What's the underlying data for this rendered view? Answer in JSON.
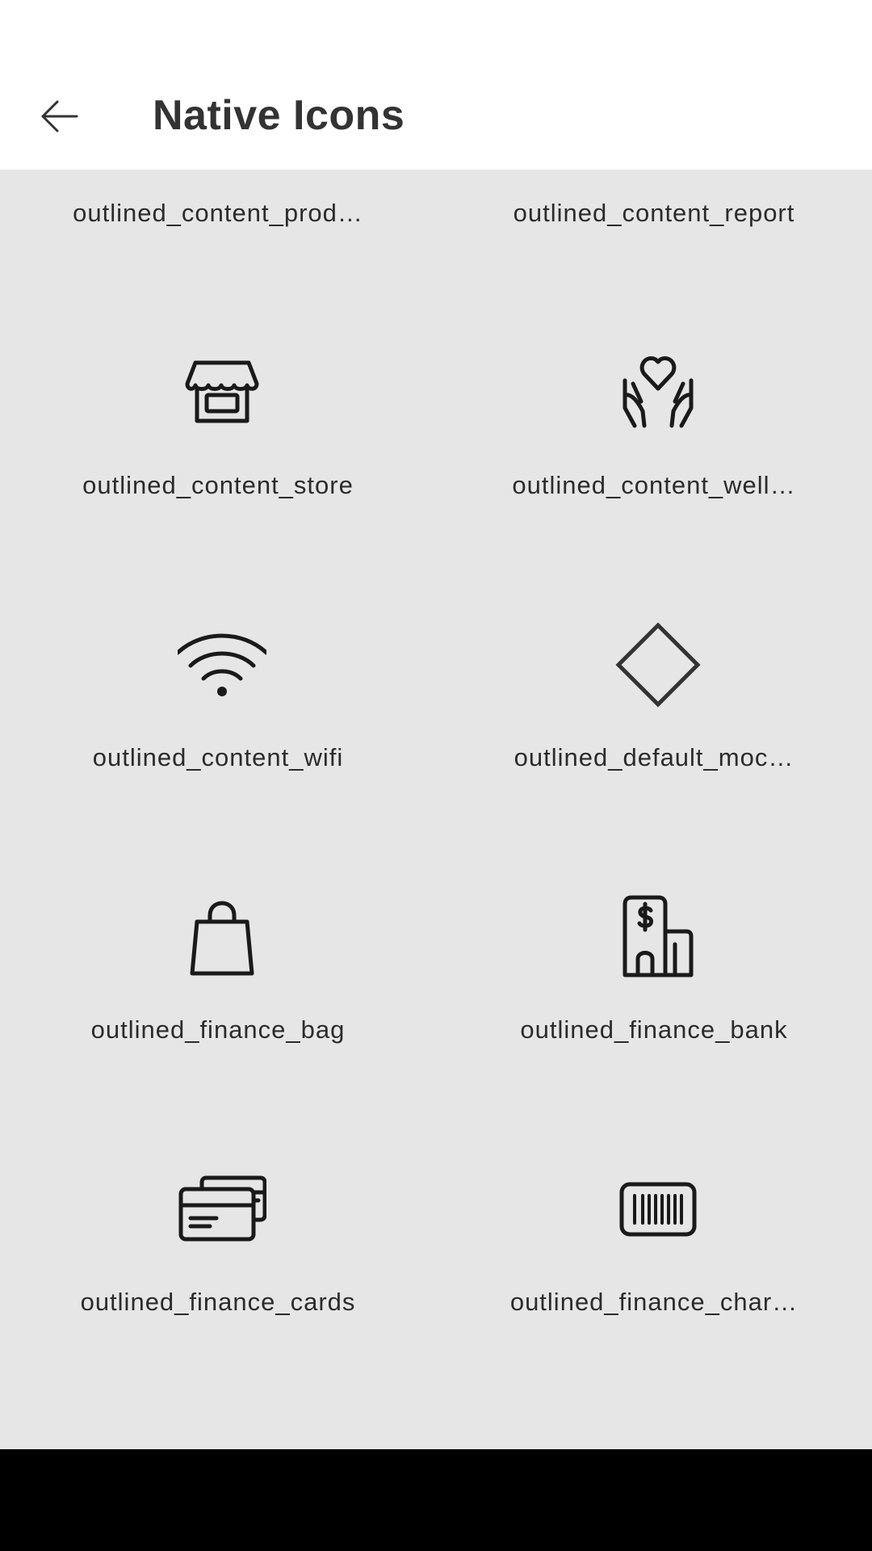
{
  "app_bar": {
    "title": "Native Icons",
    "back_icon": "arrow-left-icon"
  },
  "icons": [
    {
      "label": "outlined_content_prod…",
      "icon": "hand-holding-product-icon"
    },
    {
      "label": "outlined_content_report",
      "icon": "report-checklist-icon"
    },
    {
      "label": "outlined_content_store",
      "icon": "store-icon"
    },
    {
      "label": "outlined_content_well…",
      "icon": "hands-heart-wellness-icon"
    },
    {
      "label": "outlined_content_wifi",
      "icon": "wifi-icon"
    },
    {
      "label": "outlined_default_moc…",
      "icon": "diamond-icon"
    },
    {
      "label": "outlined_finance_bag",
      "icon": "shopping-bag-icon"
    },
    {
      "label": "outlined_finance_bank",
      "icon": "bank-building-icon"
    },
    {
      "label": "outlined_finance_cards",
      "icon": "credit-cards-icon"
    },
    {
      "label": "outlined_finance_char…",
      "icon": "barcode-card-icon"
    }
  ],
  "colors": {
    "background": "#e6e6e6",
    "app_bar": "#ffffff",
    "icon_stroke": "#1a1a1a",
    "title_text": "#333333"
  }
}
